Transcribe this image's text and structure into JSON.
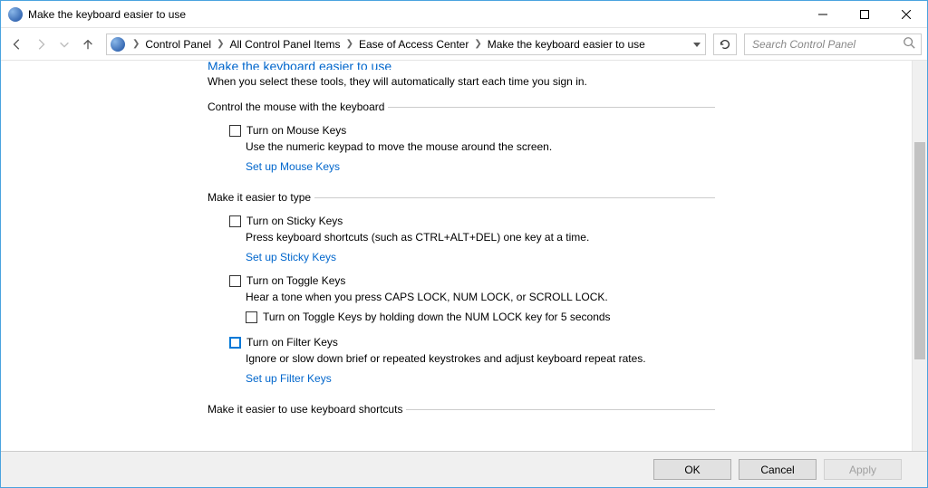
{
  "window": {
    "title": "Make the keyboard easier to use"
  },
  "breadcrumbs": {
    "b0": "Control Panel",
    "b1": "All Control Panel Items",
    "b2": "Ease of Access Center",
    "b3": "Make the keyboard easier to use"
  },
  "search": {
    "placeholder": "Search Control Panel"
  },
  "page": {
    "title": "Make the keyboard easier to use",
    "subtitle": "When you select these tools, they will automatically start each time you sign in."
  },
  "group1": {
    "legend": "Control the mouse with the keyboard",
    "mousekeys_label": "Turn on Mouse Keys",
    "mousekeys_desc": "Use the numeric keypad to move the mouse around the screen.",
    "mousekeys_link": "Set up Mouse Keys"
  },
  "group2": {
    "legend": "Make it easier to type",
    "sticky_label": "Turn on Sticky Keys",
    "sticky_desc": "Press keyboard shortcuts (such as CTRL+ALT+DEL) one key at a time.",
    "sticky_link": "Set up Sticky Keys",
    "toggle_label": "Turn on Toggle Keys",
    "toggle_desc": "Hear a tone when you press CAPS LOCK, NUM LOCK, or SCROLL LOCK.",
    "toggle_sub_label": "Turn on Toggle Keys by holding down the NUM LOCK key for 5 seconds",
    "filter_label": "Turn on Filter Keys",
    "filter_desc": "Ignore or slow down brief or repeated keystrokes and adjust keyboard repeat rates.",
    "filter_link": "Set up Filter Keys"
  },
  "group3": {
    "legend": "Make it easier to use keyboard shortcuts"
  },
  "buttons": {
    "ok": "OK",
    "cancel": "Cancel",
    "apply": "Apply"
  }
}
